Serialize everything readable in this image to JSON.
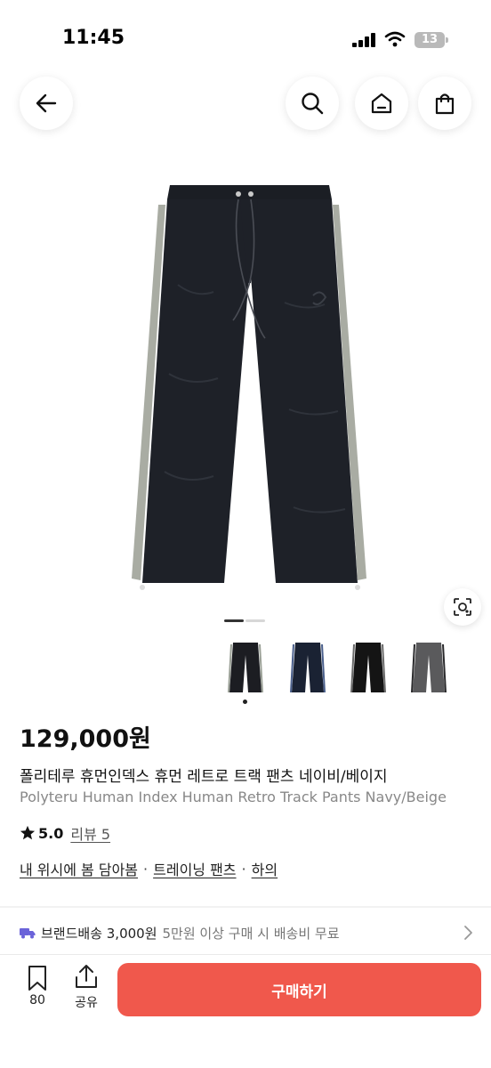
{
  "status_bar": {
    "time": "11:45",
    "battery": "13"
  },
  "product": {
    "price": "129,000원",
    "title_ko": "폴리테루 휴먼인덱스 휴먼 레트로 트랙 팬츠 네이비/베이지",
    "title_en": "Polyteru Human Index Human Retro Track Pants Navy/Beige",
    "rating": "5.0",
    "review_label": "리뷰 5"
  },
  "categories": [
    {
      "label": "내 위시에 봄 담아봄"
    },
    {
      "label": "트레이닝 팬츠"
    },
    {
      "label": "하의"
    }
  ],
  "separator": "·",
  "shipping": {
    "main": "브랜드배송 3,000원",
    "sub": "5만원 이상 구매 시 배송비 무료"
  },
  "bottom_bar": {
    "bookmark_count": "80",
    "share_label": "공유",
    "buy_label": "구매하기"
  },
  "colors": {
    "accent": "#f0584c",
    "shipping_icon": "#6b63d9"
  },
  "icons": [
    "back-arrow-icon",
    "search-icon",
    "home-icon",
    "shopping-bag-icon",
    "lens-icon",
    "star-icon",
    "truck-icon",
    "chevron-right-icon",
    "bookmark-icon",
    "share-icon"
  ]
}
